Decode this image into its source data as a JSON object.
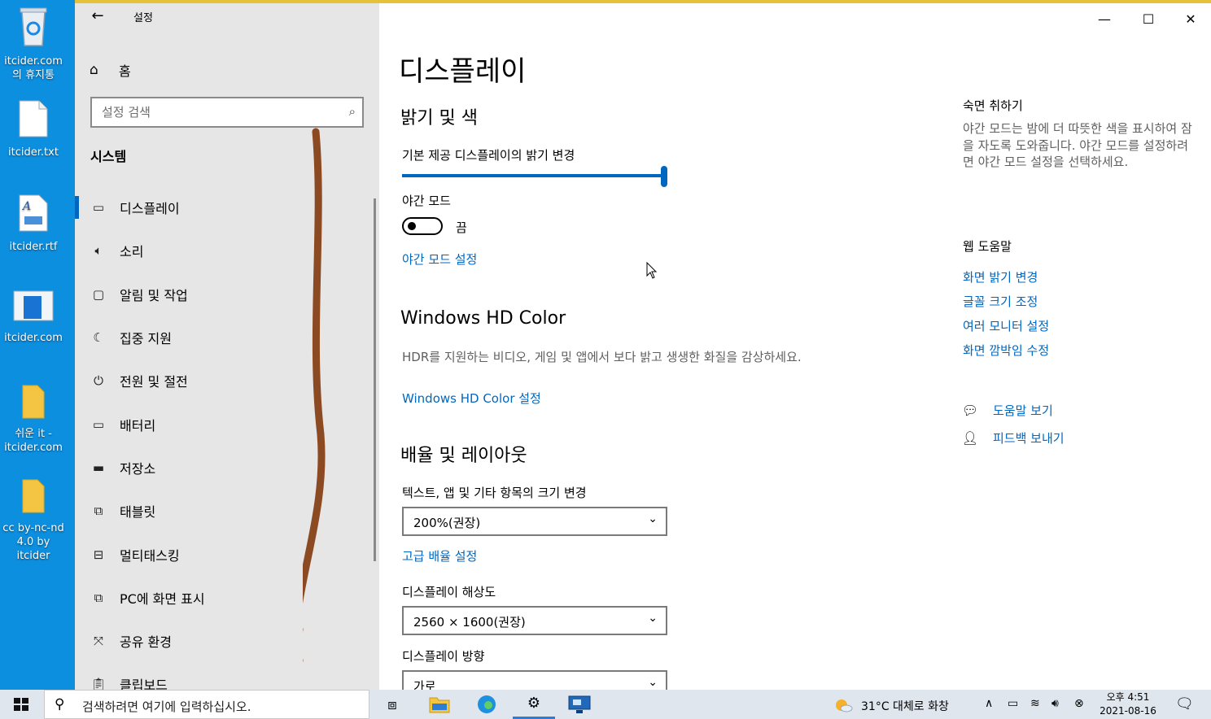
{
  "desktop": {
    "icons": [
      {
        "label": "itcider.com의 휴지통",
        "icon": "recycle-bin-icon"
      },
      {
        "label": "itcider.txt",
        "icon": "text-file-icon"
      },
      {
        "label": "itcider.rtf",
        "icon": "rtf-file-icon"
      },
      {
        "label": "itcider.com",
        "icon": "web-shortcut-icon"
      },
      {
        "label": "쉬운 it - itcider.com",
        "icon": "folder-icon"
      },
      {
        "label": "cc by-nc-nd 4.0 by itcider",
        "icon": "folder-icon"
      }
    ]
  },
  "window": {
    "title": "설정",
    "accent_color": "#0067c0"
  },
  "nav": {
    "home_label": "홈",
    "search_placeholder": "설정 검색",
    "group_title": "시스템",
    "items": [
      {
        "label": "디스플레이",
        "icon": "monitor-icon",
        "selected": true
      },
      {
        "label": "소리",
        "icon": "speaker-icon"
      },
      {
        "label": "알림 및 작업",
        "icon": "notification-icon"
      },
      {
        "label": "집중 지원",
        "icon": "moon-icon"
      },
      {
        "label": "전원 및 절전",
        "icon": "power-icon"
      },
      {
        "label": "배터리",
        "icon": "battery-icon"
      },
      {
        "label": "저장소",
        "icon": "storage-icon"
      },
      {
        "label": "태블릿",
        "icon": "tablet-icon"
      },
      {
        "label": "멀티태스킹",
        "icon": "multitasking-icon"
      },
      {
        "label": "PC에 화면 표시",
        "icon": "project-icon"
      },
      {
        "label": "공유 환경",
        "icon": "shared-experiences-icon"
      },
      {
        "label": "클립보드",
        "icon": "clipboard-icon"
      }
    ]
  },
  "content": {
    "page_title": "디스플레이",
    "brightness": {
      "section_title": "밝기 및 색",
      "slider_label": "기본 제공 디스플레이의 밝기 변경",
      "slider_value": 100
    },
    "night_light": {
      "label": "야간 모드",
      "state_label": "끔",
      "on": false,
      "settings_link": "야간 모드 설정"
    },
    "hd_color": {
      "section_title": "Windows HD Color",
      "description": "HDR를 지원하는 비디오, 게임 및 앱에서 보다 밝고 생생한 화질을 감상하세요.",
      "settings_link": "Windows HD Color 설정"
    },
    "scale_layout": {
      "section_title": "배율 및 레이아웃",
      "scale_label": "텍스트, 앱 및 기타 항목의 크기 변경",
      "scale_value": "200%(권장)",
      "advanced_link": "고급 배율 설정",
      "resolution_label": "디스플레이 해상도",
      "resolution_value": "2560 × 1600(권장)",
      "orientation_label": "디스플레이 방향",
      "orientation_value": "가로"
    }
  },
  "right": {
    "sleep_title": "숙면 취하기",
    "sleep_desc": "야간 모드는 밤에 더 따뜻한 색을 표시하여 잠을 자도록 도와줍니다. 야간 모드를 설정하려면 야간 모드 설정을 선택하세요.",
    "web_help_title": "웹 도움말",
    "web_links": [
      "화면 밝기 변경",
      "글꼴 크기 조정",
      "여러 모니터 설정",
      "화면 깜박임 수정"
    ],
    "get_help": "도움말 보기",
    "feedback": "피드백 보내기"
  },
  "caption": {
    "minimize": "—",
    "maximize": "☐",
    "close": "✕"
  },
  "taskbar": {
    "search_placeholder": "검색하려면 여기에 입력하십시오.",
    "weather": "31°C  대체로 화창",
    "time": "오후 4:51",
    "date": "2021-08-16",
    "apps": [
      "task-view-icon",
      "file-explorer-icon",
      "edge-icon",
      "settings-icon",
      "remote-desktop-icon"
    ]
  },
  "annotation_arrow_color": "#8b4a22"
}
